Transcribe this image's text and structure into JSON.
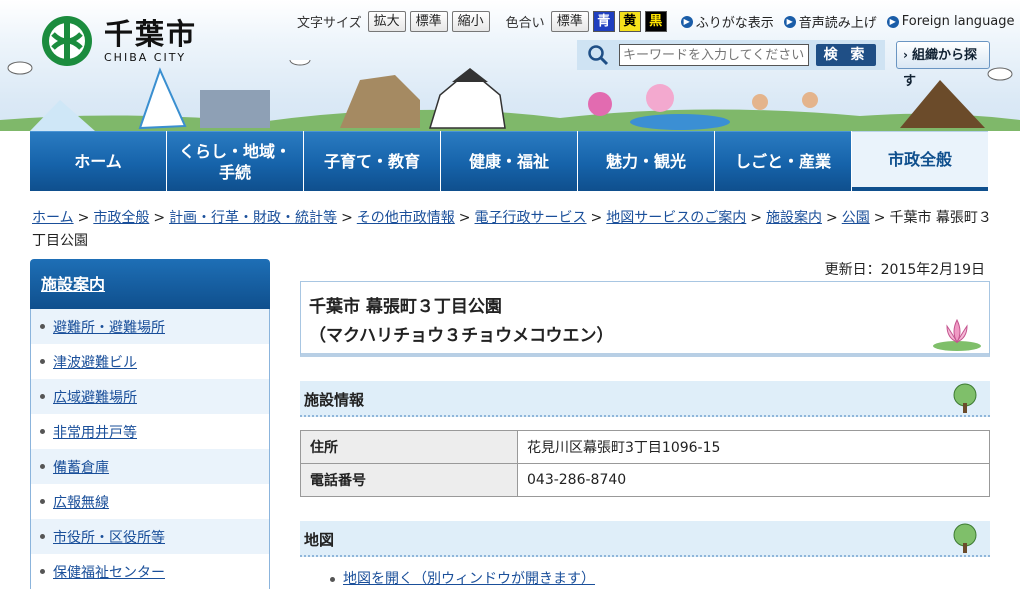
{
  "header": {
    "logo_jp": "千葉市",
    "logo_en": "CHIBA CITY",
    "font_size_label": "文字サイズ",
    "font_buttons": [
      "拡大",
      "標準",
      "縮小"
    ],
    "color_label": "色合い",
    "color_standard": "標準",
    "color_buttons": [
      {
        "label": "青",
        "bg": "#1f3fbf",
        "fg": "#ffffff"
      },
      {
        "label": "黄",
        "bg": "#f5e11b",
        "fg": "#000000"
      },
      {
        "label": "黒",
        "bg": "#000000",
        "fg": "#ffe400"
      }
    ],
    "furigana": "ふりがな表示",
    "voice": "音声読み上げ",
    "foreign": "Foreign language",
    "search_placeholder": "キーワードを入力してください",
    "search_button": "検 索",
    "org_button": "組織から探す"
  },
  "gnav": [
    {
      "line1": "ホーム",
      "line2": ""
    },
    {
      "line1": "くらし・地域・",
      "line2": "手続"
    },
    {
      "line1": "子育て・教育",
      "line2": ""
    },
    {
      "line1": "健康・福祉",
      "line2": ""
    },
    {
      "line1": "魅力・観光",
      "line2": ""
    },
    {
      "line1": "しごと・産業",
      "line2": ""
    },
    {
      "line1": "市政全般",
      "line2": ""
    }
  ],
  "breadcrumb": {
    "links": [
      "ホーム",
      "市政全般",
      "計画・行革・財政・統計等",
      "その他市政情報",
      "電子行政サービス",
      "地図サービスのご案内",
      "施設案内",
      "公園"
    ],
    "current": "千葉市 幕張町３丁目公園"
  },
  "side": {
    "title": "施設案内",
    "items": [
      "避難所・避難場所",
      "津波避難ビル",
      "広域避難場所",
      "非常用井戸等",
      "備蓄倉庫",
      "広報無線",
      "市役所・区役所等",
      "保健福祉センター"
    ]
  },
  "main": {
    "updated": "更新日：2015年2月19日",
    "title_line1": "千葉市 幕張町３丁目公園",
    "title_line2": "（マクハリチョウ３チョウメコウエン）",
    "section_info": "施設情報",
    "rows": [
      {
        "label": "住所",
        "value": "花見川区幕張町3丁目1096-15"
      },
      {
        "label": "電話番号",
        "value": "043-286-8740"
      }
    ],
    "section_map": "地図",
    "map_link": "地図を開く（別ウィンドウが開きます）"
  },
  "colors": {
    "nav_blue": "#1663aa",
    "link": "#1a4f9a",
    "section_bg": "#dfeef9"
  }
}
